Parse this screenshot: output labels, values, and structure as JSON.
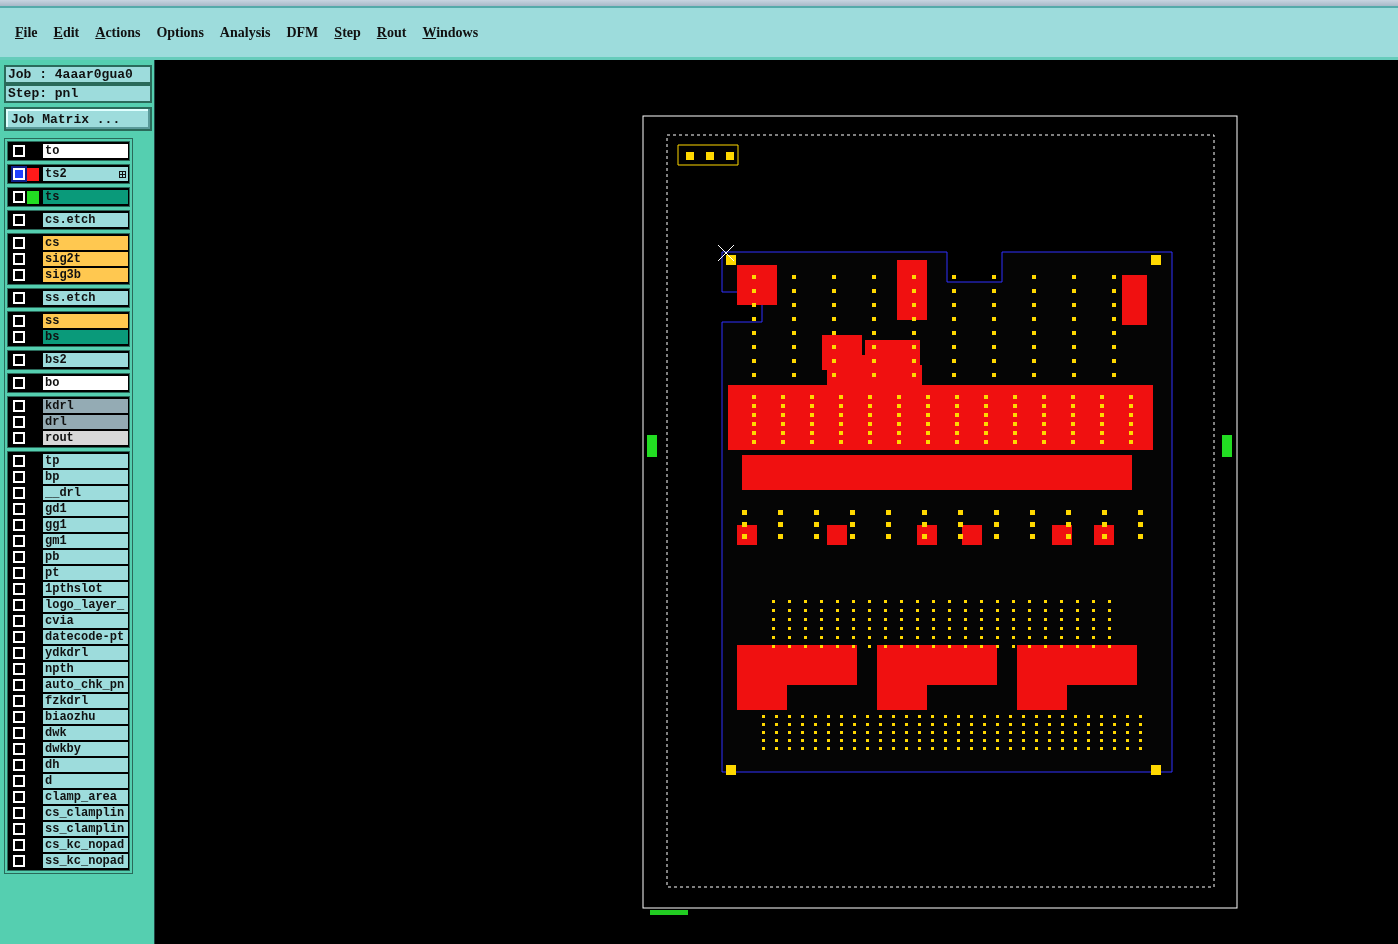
{
  "menu": [
    {
      "label": "File",
      "mnemonic": true
    },
    {
      "label": "Edit",
      "mnemonic": true
    },
    {
      "label": "Actions",
      "mnemonic": true
    },
    {
      "label": "Options",
      "mnemonic": false
    },
    {
      "label": "Analysis",
      "mnemonic": false
    },
    {
      "label": "DFM",
      "mnemonic": false
    },
    {
      "label": "Step",
      "mnemonic": true
    },
    {
      "label": "Rout",
      "mnemonic": true
    },
    {
      "label": "Windows",
      "mnemonic": true
    }
  ],
  "job": "Job : 4aaar0gua0",
  "step": "Step: pnl",
  "job_matrix_button": "Job Matrix ...",
  "layer_groups": [
    {
      "layers": [
        {
          "name": "to",
          "color": "#ffffff",
          "active": false
        }
      ]
    },
    {
      "layers": [
        {
          "name": "ts2",
          "color": "#9ddcdc",
          "active": true,
          "swatch": {
            "color": "#ff1a1a"
          }
        }
      ]
    },
    {
      "layers": [
        {
          "name": "ts",
          "color": "#0a9a7a",
          "active": false,
          "swatch": {
            "color": "#22dd22"
          }
        }
      ]
    },
    {
      "layers": [
        {
          "name": "cs.etch",
          "color": "#9ddcdc",
          "active": false
        }
      ]
    },
    {
      "layers": [
        {
          "name": "cs",
          "color": "#ffc850",
          "active": false
        },
        {
          "name": "sig2t",
          "color": "#ffc850",
          "active": false
        },
        {
          "name": "sig3b",
          "color": "#ffc850",
          "active": false
        }
      ]
    },
    {
      "layers": [
        {
          "name": "ss.etch",
          "color": "#9ddcdc",
          "active": false
        }
      ]
    },
    {
      "layers": [
        {
          "name": "ss",
          "color": "#ffc850",
          "active": false
        },
        {
          "name": "bs",
          "color": "#0a9a7a",
          "active": false
        }
      ]
    },
    {
      "layers": [
        {
          "name": "bs2",
          "color": "#9ddcdc",
          "active": false
        }
      ]
    },
    {
      "layers": [
        {
          "name": "bo",
          "color": "#ffffff",
          "active": false
        }
      ]
    },
    {
      "layers": [
        {
          "name": "kdrl",
          "color": "#94abb4",
          "active": false
        },
        {
          "name": "drl",
          "color": "#94abb4",
          "active": false
        },
        {
          "name": "rout",
          "color": "#d8d8d8",
          "active": false
        }
      ]
    },
    {
      "layers": [
        {
          "name": "tp",
          "color": "#9ddcdc",
          "active": false
        },
        {
          "name": "bp",
          "color": "#9ddcdc",
          "active": false
        },
        {
          "name": "__drl",
          "color": "#9ddcdc",
          "active": false
        },
        {
          "name": "gd1",
          "color": "#9ddcdc",
          "active": false
        },
        {
          "name": "gg1",
          "color": "#9ddcdc",
          "active": false
        },
        {
          "name": "gm1",
          "color": "#9ddcdc",
          "active": false
        },
        {
          "name": "pb",
          "color": "#9ddcdc",
          "active": false
        },
        {
          "name": "pt",
          "color": "#9ddcdc",
          "active": false
        },
        {
          "name": "1pthslot",
          "color": "#9ddcdc",
          "active": false
        },
        {
          "name": "logo_layer_",
          "color": "#9ddcdc",
          "active": false
        },
        {
          "name": "cvia",
          "color": "#9ddcdc",
          "active": false
        },
        {
          "name": "datecode-pt",
          "color": "#9ddcdc",
          "active": false
        },
        {
          "name": "ydkdrl",
          "color": "#9ddcdc",
          "active": false
        },
        {
          "name": "npth",
          "color": "#9ddcdc",
          "active": false
        },
        {
          "name": "auto_chk_pn",
          "color": "#9ddcdc",
          "active": false
        },
        {
          "name": "fzkdrl",
          "color": "#9ddcdc",
          "active": false
        },
        {
          "name": "biaozhu",
          "color": "#9ddcdc",
          "active": false
        },
        {
          "name": "dwk",
          "color": "#9ddcdc",
          "active": false
        },
        {
          "name": "dwkby",
          "color": "#9ddcdc",
          "active": false
        },
        {
          "name": "dh",
          "color": "#9ddcdc",
          "active": false
        },
        {
          "name": "d",
          "color": "#9ddcdc",
          "active": false
        },
        {
          "name": "clamp_area",
          "color": "#9ddcdc",
          "active": false
        },
        {
          "name": "cs_clamplin",
          "color": "#9ddcdc",
          "active": false
        },
        {
          "name": "ss_clamplin",
          "color": "#9ddcdc",
          "active": false
        },
        {
          "name": "cs_kc_nopad",
          "color": "#9ddcdc",
          "active": false
        },
        {
          "name": "ss_kc_nopad",
          "color": "#9ddcdc",
          "active": false
        }
      ]
    }
  ]
}
